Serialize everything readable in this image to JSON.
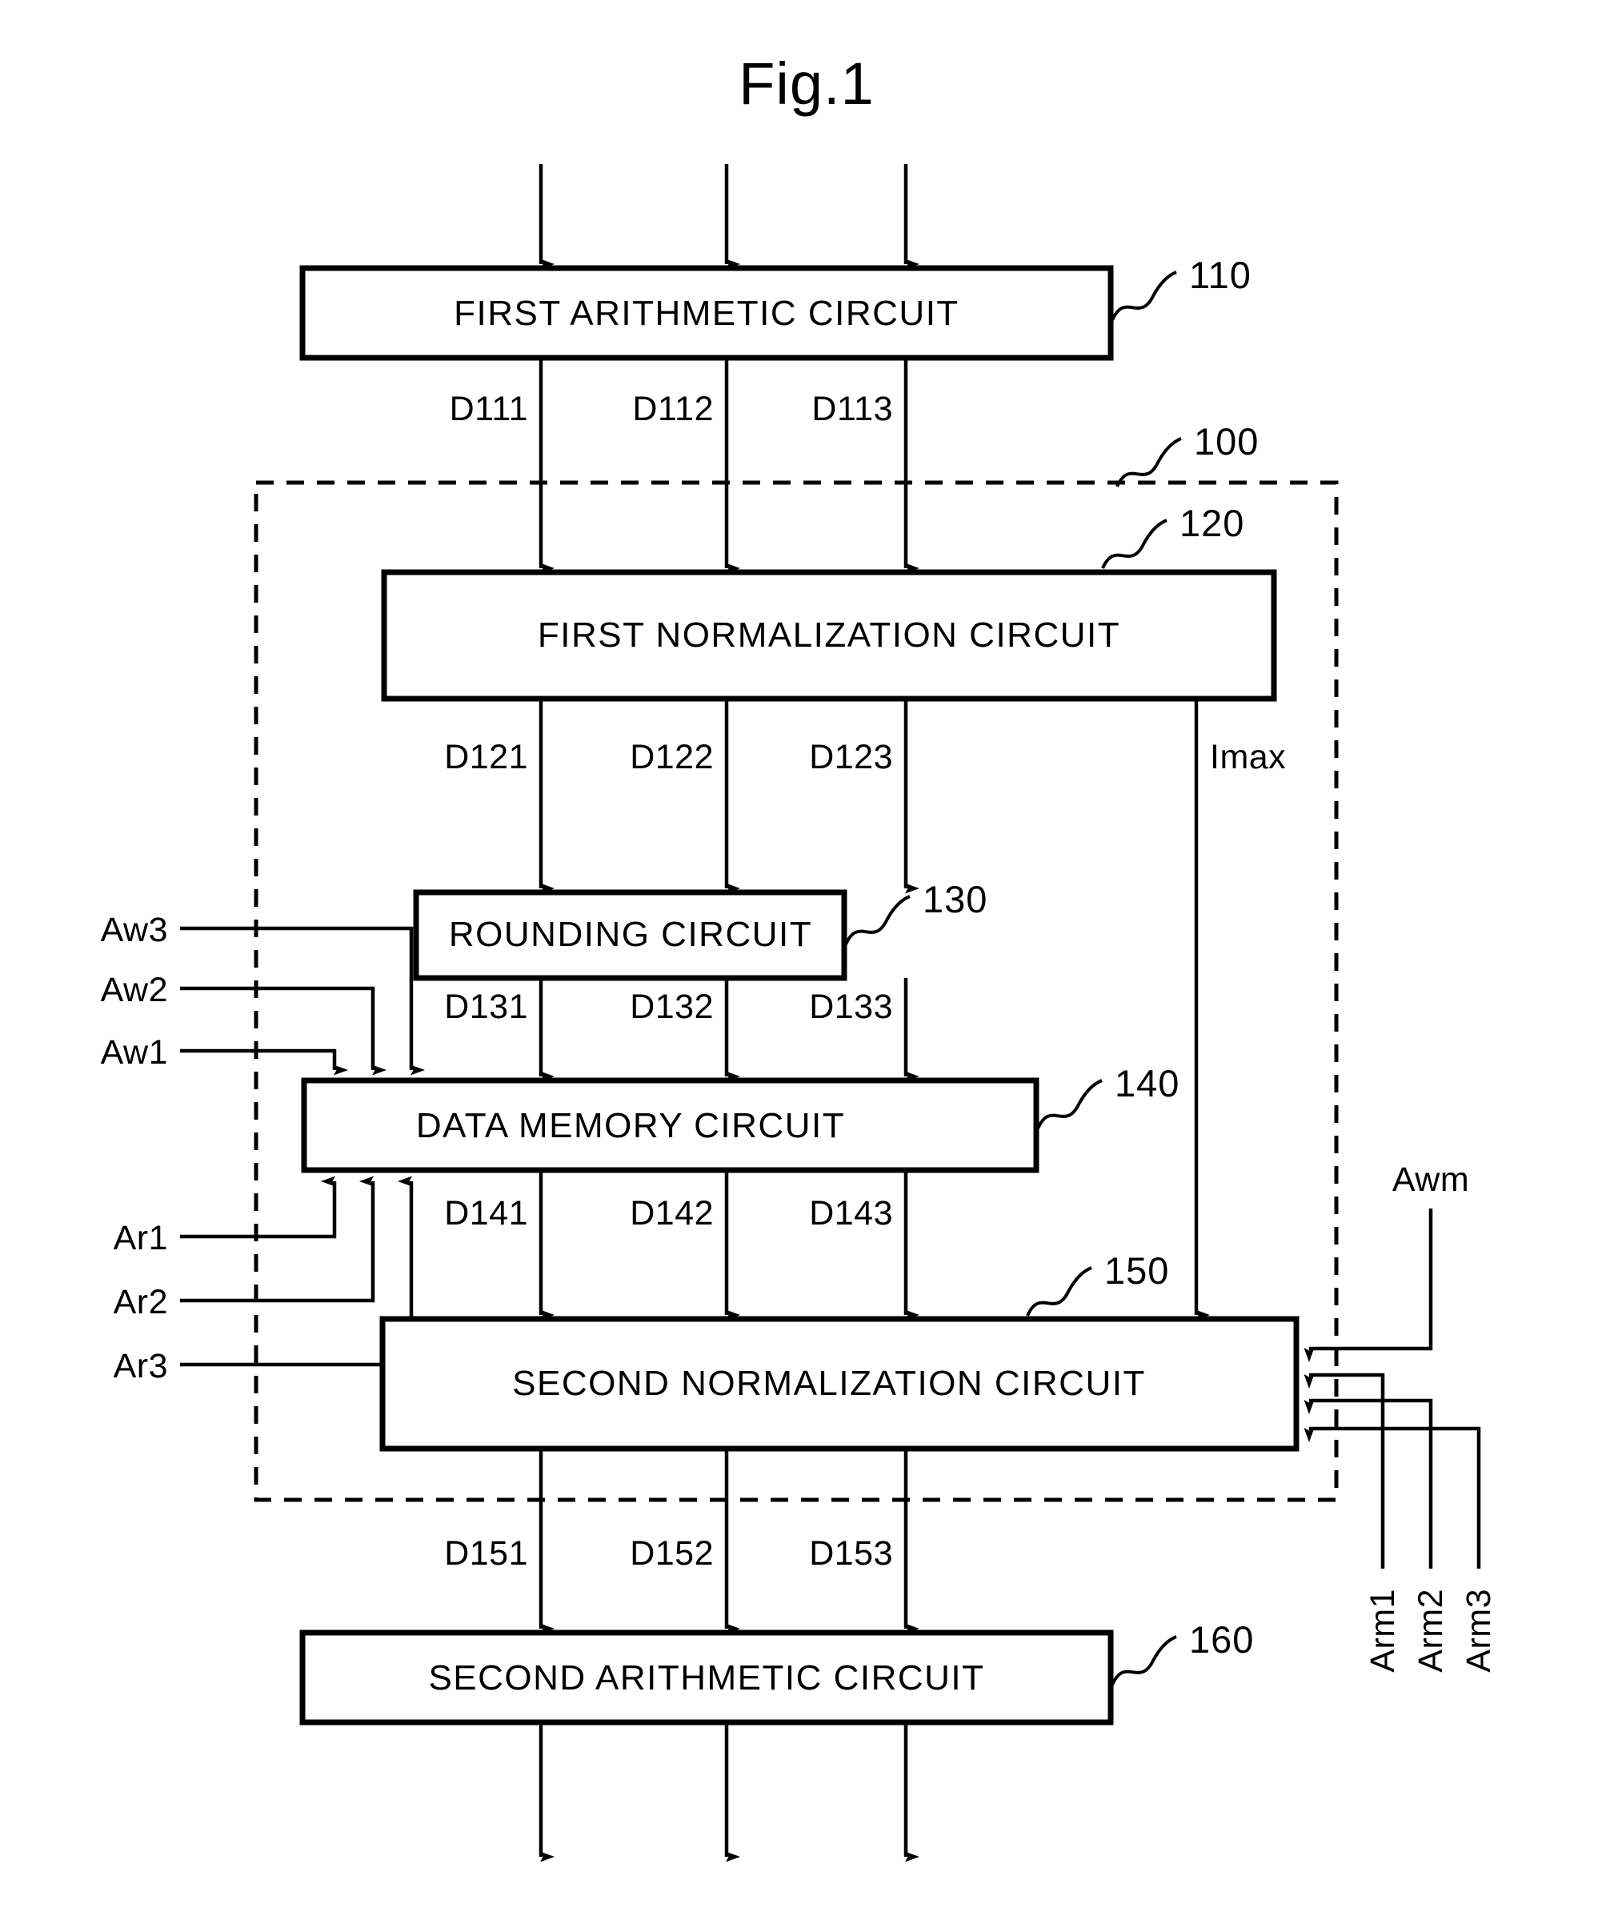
{
  "figure": {
    "title": "Fig.1"
  },
  "blocks": [
    {
      "id": "110",
      "label": "FIRST ARITHMETIC CIRCUIT",
      "ref": "110"
    },
    {
      "id": "120",
      "label": "FIRST NORMALIZATION CIRCUIT",
      "ref": "120"
    },
    {
      "id": "130",
      "label": "ROUNDING CIRCUIT",
      "ref": "130"
    },
    {
      "id": "140",
      "label": "DATA MEMORY CIRCUIT",
      "ref": "140"
    },
    {
      "id": "150",
      "label": "SECOND NORMALIZATION CIRCUIT",
      "ref": "150"
    },
    {
      "id": "160",
      "label": "SECOND ARITHMETIC CIRCUIT",
      "ref": "160"
    }
  ],
  "region": {
    "ref": "100"
  },
  "signals": {
    "from_110": [
      "D111",
      "D112",
      "D113"
    ],
    "from_120": [
      "D121",
      "D122",
      "D123"
    ],
    "from_130": [
      "D131",
      "D132",
      "D133"
    ],
    "from_140": [
      "D141",
      "D142",
      "D143"
    ],
    "from_150": [
      "D151",
      "D152",
      "D153"
    ],
    "imax": "Imax"
  },
  "write_addresses": [
    "Aw1",
    "Aw2",
    "Aw3"
  ],
  "read_addresses": [
    "Ar1",
    "Ar2",
    "Ar3"
  ],
  "norm_addresses": {
    "awm": "Awm",
    "arm": [
      "Arm1",
      "Arm2",
      "Arm3"
    ]
  },
  "colors": {
    "ink": "#000000",
    "paper": "#ffffff"
  }
}
